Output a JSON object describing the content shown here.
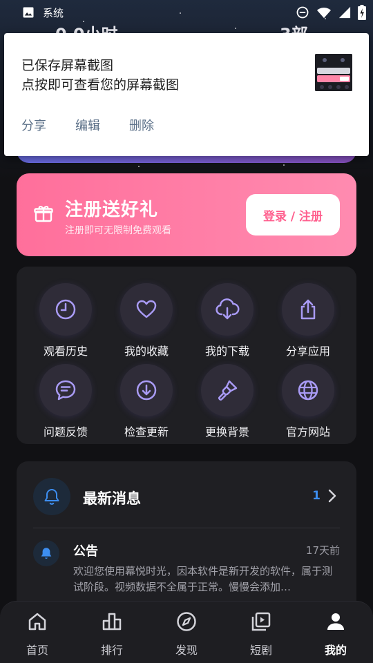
{
  "status_bar": {
    "label": "系统"
  },
  "peek": {
    "left": "0.0小时",
    "right": "3部"
  },
  "toast": {
    "title": "已保存屏幕截图",
    "subtitle": "点按即可查看您的屏幕截图",
    "actions": [
      "分享",
      "编辑",
      "删除"
    ]
  },
  "register": {
    "title": "注册送好礼",
    "subtitle": "注册即可无限制免费观看",
    "button": "登录 / 注册"
  },
  "grid": {
    "items": [
      {
        "label": "观看历史",
        "icon": "clock-icon"
      },
      {
        "label": "我的收藏",
        "icon": "heart-icon"
      },
      {
        "label": "我的下载",
        "icon": "cloud-download-icon"
      },
      {
        "label": "分享应用",
        "icon": "share-icon"
      },
      {
        "label": "问题反馈",
        "icon": "chat-icon"
      },
      {
        "label": "检查更新",
        "icon": "download-circle-icon"
      },
      {
        "label": "更换背景",
        "icon": "brush-icon"
      },
      {
        "label": "官方网站",
        "icon": "globe-icon"
      }
    ]
  },
  "news": {
    "title": "最新消息",
    "count": "1",
    "item": {
      "title": "公告",
      "time": "17天前",
      "body": "欢迎您使用幕悦时光，因本软件是新开发的软件，属于测试阶段。视频数据不全属于正常。慢慢会添加…"
    }
  },
  "nav": {
    "items": [
      {
        "label": "首页",
        "icon": "home-icon"
      },
      {
        "label": "排行",
        "icon": "ranking-icon"
      },
      {
        "label": "发现",
        "icon": "compass-icon"
      },
      {
        "label": "短剧",
        "icon": "video-library-icon"
      },
      {
        "label": "我的",
        "icon": "user-icon"
      }
    ],
    "active": "我的"
  },
  "colors": {
    "accent_purple": "#a99bf5",
    "pink_start": "#ff6f9b",
    "pink_end": "#ff8bb0",
    "blue": "#3d8ef0"
  }
}
